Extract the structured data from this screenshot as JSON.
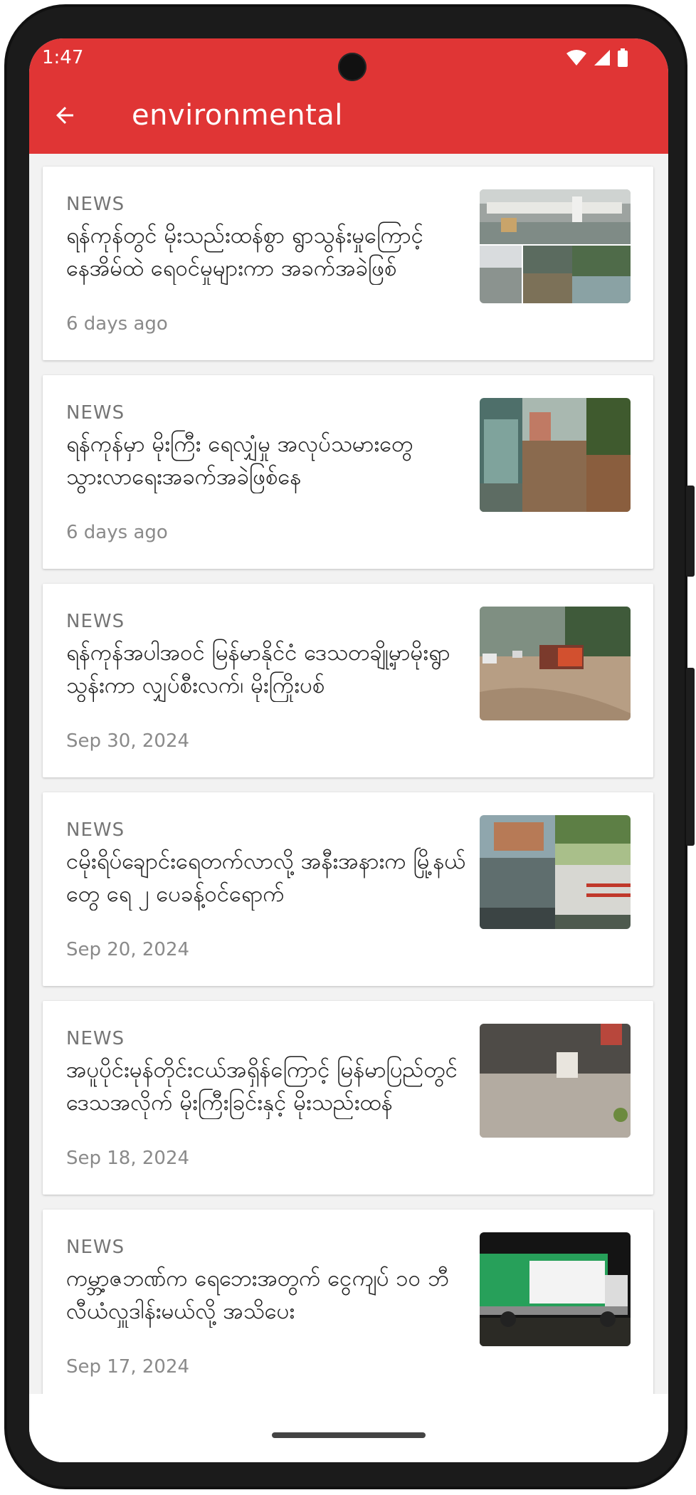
{
  "status_bar": {
    "time": "1:47",
    "icons": [
      "wifi-icon",
      "signal-icon",
      "battery-icon"
    ]
  },
  "app_bar": {
    "title": "environmental",
    "back_icon": "arrow-back-icon",
    "color": "#e03535"
  },
  "articles": [
    {
      "category": "NEWS",
      "title": "ရန်ကုန်တွင် မိုးသည်းထန်စွာ ရွာသွန်းမှုကြောင့် နေအိမ်ထဲ ရေဝင်မှုများကာ အခက်အခဲဖြစ်",
      "time": "6 days ago",
      "thumbnail": "flooded-street-collage"
    },
    {
      "category": "NEWS",
      "title": "ရန်ကုန်မှာ မိုးကြီး ရေလျှံမှု အလုပ်သမားတွေ သွားလာရေးအခက်အခဲဖြစ်နေ",
      "time": "6 days ago",
      "thumbnail": "flooded-alley-collage"
    },
    {
      "category": "NEWS",
      "title": "ရန်ကုန်အပါအဝင် မြန်မာနိုင်ငံ ဒေသတချို့မှာမိုးရွာသွန်းကာ လျှပ်စီးလက်၊ မိုးကြိုးပစ်",
      "time": "Sep 30, 2024",
      "thumbnail": "flooded-road-truck"
    },
    {
      "category": "NEWS",
      "title": "ငမိုးရိပ်ချောင်းရေတက်လာလို့ အနီးအနားက မြို့နယ်တွေ ရေ ၂ ပေခန့်ဝင်ရောက်",
      "time": "Sep 20, 2024",
      "thumbnail": "flood-water-level"
    },
    {
      "category": "NEWS",
      "title": "အပူပိုင်းမုန်တိုင်းငယ်အရှိန်ကြောင့် မြန်မာပြည်တွင် ဒေသအလိုက် မိုးကြီးခြင်းနှင့် မိုးသည်းထန်",
      "time": "Sep 18, 2024",
      "thumbnail": "heavy-rain-street"
    },
    {
      "category": "NEWS",
      "title": "ကမ္ဘာ့ဇဘဏ်က ရေဘေးအတွက်  ငွေကျပ် ၁၀ ဘီလီယံလှူဒါန်းမယ်လို့ အသိပေး",
      "time": "Sep 17, 2024",
      "thumbnail": "relief-truck-night"
    }
  ]
}
